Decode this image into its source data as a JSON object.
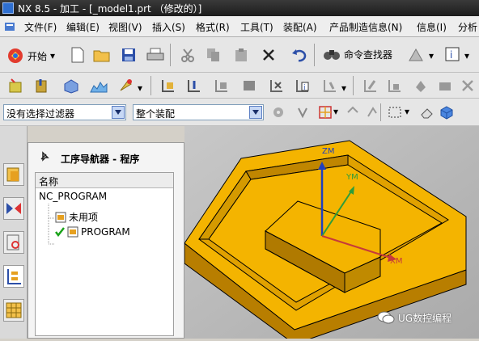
{
  "window": {
    "title": "NX 8.5 - 加工 - [_model1.prt （修改的）]"
  },
  "menubar": {
    "items": [
      "文件(F)",
      "编辑(E)",
      "视图(V)",
      "插入(S)",
      "格式(R)",
      "工具(T)",
      "装配(A)",
      "产品制造信息(N)",
      "信息(I)",
      "分析"
    ]
  },
  "toolbar": {
    "start_label": "开始",
    "command_finder_label": "命令查找器"
  },
  "filters": {
    "selection_filter": "没有选择过滤器",
    "assembly_scope": "整个装配"
  },
  "navigator": {
    "title": "工序导航器 - 程序",
    "column_name": "名称",
    "items": [
      "NC_PROGRAM",
      "未用项",
      "PROGRAM"
    ]
  },
  "axes": {
    "z": "ZM",
    "y": "YM",
    "x": "XM"
  },
  "watermark": "UG数控编程",
  "colors": {
    "part": "#f4b400",
    "axis_z": "#1f3fbf",
    "axis_y": "#2f9d3a",
    "axis_x": "#c63a3a",
    "check": "#1aa31a"
  }
}
